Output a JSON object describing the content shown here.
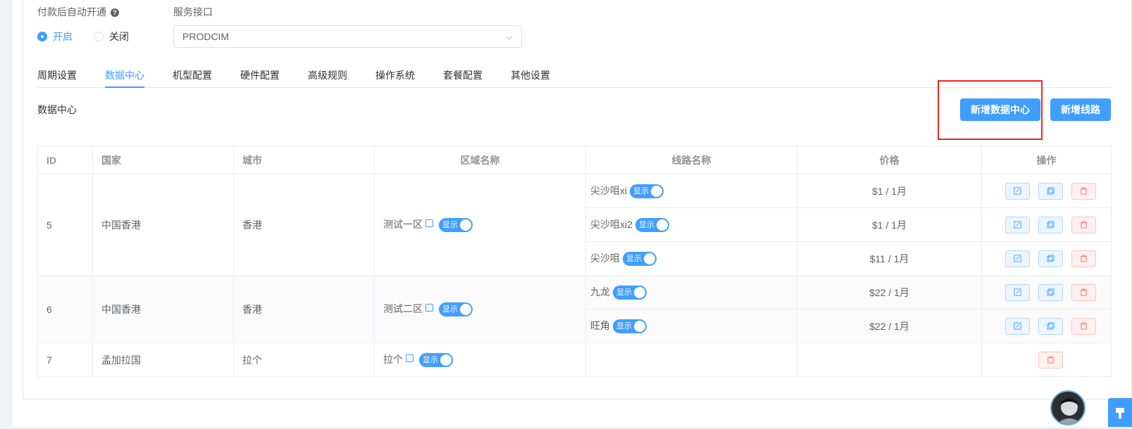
{
  "form": {
    "auto_open_label": "付款后自动开通",
    "radio_on": "开启",
    "radio_off": "关闭",
    "api_label": "服务接口",
    "api_value": "PRODCIM"
  },
  "tabs": [
    "周期设置",
    "数据中心",
    "机型配置",
    "硬件配置",
    "高级规则",
    "操作系统",
    "套餐配置",
    "其他设置"
  ],
  "section_title": "数据中心",
  "buttons": {
    "add_datacenter": "新增数据中心",
    "add_line": "新增线路"
  },
  "table": {
    "headers": [
      "ID",
      "国家",
      "城市",
      "区域名称",
      "线路名称",
      "价格",
      "操作"
    ],
    "toggle_text": "显示",
    "groups": [
      {
        "id": "5",
        "country": "中国香港",
        "city": "香港",
        "area": "测试一区",
        "lines": [
          {
            "name": "尖沙咀xi",
            "price": "$1 / 1月"
          },
          {
            "name": "尖沙咀xi2",
            "price": "$1 / 1月"
          },
          {
            "name": "尖沙咀",
            "price": "$11 / 1月"
          }
        ]
      },
      {
        "id": "6",
        "country": "中国香港",
        "city": "香港",
        "area": "测试二区",
        "lines": [
          {
            "name": "九龙",
            "price": "$22 / 1月"
          },
          {
            "name": "旺角",
            "price": "$22 / 1月"
          }
        ]
      },
      {
        "id": "7",
        "country": "孟加拉国",
        "city": "拉个",
        "area": "拉个",
        "lines": []
      }
    ]
  },
  "colors": {
    "primary": "#409eff",
    "danger": "#f56c6c",
    "highlight": "#ff1f1f"
  }
}
